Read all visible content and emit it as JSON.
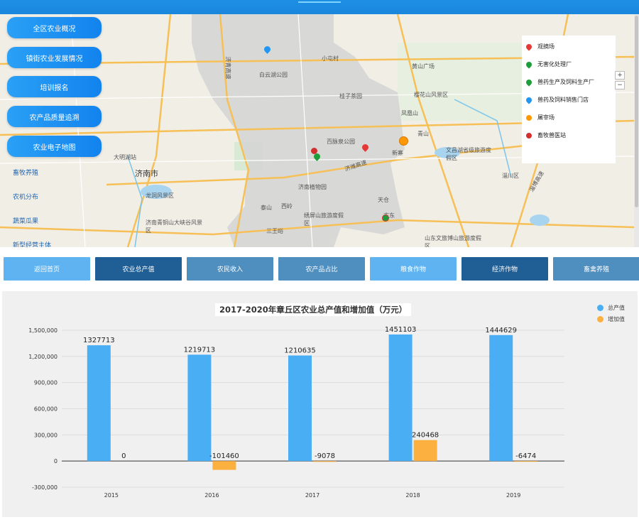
{
  "sidebar": {
    "items": [
      {
        "label": "全区农业概况"
      },
      {
        "label": "镇街农业发展情况"
      },
      {
        "label": "培训报名"
      },
      {
        "label": "农产品质量追溯"
      },
      {
        "label": "农业电子地图"
      }
    ]
  },
  "map": {
    "labels": {
      "jinan": "济南市",
      "xuejiajie": "薛家街道",
      "tiefengdian": "大明湖站",
      "longtan": "龙洞风景区",
      "qingtong": "济南青铜山大峡谷风景区",
      "baiyun": "白云湖公园",
      "zhujia": "桂子茶园",
      "baimaquan": "百脉泉公园",
      "jinan_botanic": "济南植物园",
      "yongbi": "绣屏山旅游度假区",
      "sanwang": "三王峪",
      "huangshan": "黄山广场",
      "yinghuashan": "樱花山风景区",
      "fengyun": "凤凰山",
      "qingshan": "青山",
      "wenchang": "文昌湖省级旅游度假区",
      "zichuan": "淄川区",
      "shandong": "山东文旅博山旅游度假区",
      "tianqian": "天仓",
      "jiwei": "济潍高速",
      "jiqing": "济青高速",
      "zibo": "淄博高速",
      "xishan": "西岭",
      "taishan": "泰山",
      "xiaodong": "小屯村",
      "xingzhai": "新寨",
      "gudong": "古东",
      "banner1": "畜牧养殖",
      "banner2": "农机分布",
      "banner3": "蔬菜瓜果",
      "banner4": "新型经营主体"
    },
    "legend": [
      {
        "label": "观摘场",
        "color": "#e53935"
      },
      {
        "label": "无害化处理厂",
        "color": "#1e9e3a"
      },
      {
        "label": "兽药生产及饲料生产厂",
        "color": "#1e9e3a"
      },
      {
        "label": "兽药及饲料销售门店",
        "color": "#2196f3"
      },
      {
        "label": "屠宰场",
        "color": "#ff9800"
      },
      {
        "label": "畜牧兽医站",
        "color": "#d32f2f"
      }
    ]
  },
  "nav": [
    {
      "label": "返回首页",
      "color": "#5fb3f0"
    },
    {
      "label": "农业总产值",
      "color": "#1f5f96"
    },
    {
      "label": "农民收入",
      "color": "#4f8fc0"
    },
    {
      "label": "农产品占比",
      "color": "#4f8fc0"
    },
    {
      "label": "粮食作物",
      "color": "#5fb3f0"
    },
    {
      "label": "经济作物",
      "color": "#1f5f96"
    },
    {
      "label": "畜禽养殖",
      "color": "#4f8fc0"
    }
  ],
  "chart_data": {
    "type": "bar",
    "title": "2017-2020年章丘区农业总产值和增加值（万元）",
    "categories": [
      "2015",
      "2016",
      "2017",
      "2018",
      "2019"
    ],
    "series": [
      {
        "name": "总产值",
        "color": "#4aaef5",
        "values": [
          1327713,
          1219713,
          1210635,
          1451103,
          1444629
        ]
      },
      {
        "name": "增加值",
        "color": "#fbb040",
        "values": [
          0,
          -101460,
          -9078,
          240468,
          -6474
        ]
      }
    ],
    "ylim": [
      -300000,
      1500000
    ],
    "yticks": [
      "1,500,000",
      "1,200,000",
      "900,000",
      "600,000",
      "300,000",
      "0",
      "-300,000"
    ],
    "ytick_values": [
      1500000,
      1200000,
      900000,
      600000,
      300000,
      0,
      -300000
    ],
    "grid": true,
    "legend_position": "top-right"
  }
}
